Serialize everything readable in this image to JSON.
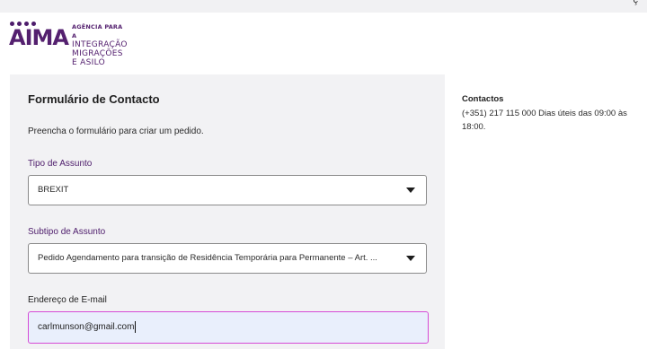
{
  "topbar": {
    "glyph": "ç"
  },
  "logo": {
    "word": "AIMA",
    "line1": "AGÊNCIA PARA A",
    "line2": "INTEGRAÇÃO",
    "line3": "MIGRAÇÕES E ASILO"
  },
  "form": {
    "title": "Formulário de Contacto",
    "intro": "Preencha o formulário para criar um pedido.",
    "tipo_label": "Tipo de Assunto",
    "tipo_value": "BREXIT",
    "subtipo_label": "Subtipo de Assunto",
    "subtipo_value": "Pedido Agendamento para transição de Residência Temporária para Permanente – Art. ...",
    "email_label": "Endereço de E-mail",
    "email_value": "carlmunson@gmail.com"
  },
  "contacts": {
    "title": "Contactos",
    "text": "(+351) 217 115 000 Dias úteis das 09:00 às 18:00."
  },
  "colors": {
    "brand": "#54206f",
    "focus_border": "#d54bd6",
    "panel_bg": "#f2f2f4"
  }
}
